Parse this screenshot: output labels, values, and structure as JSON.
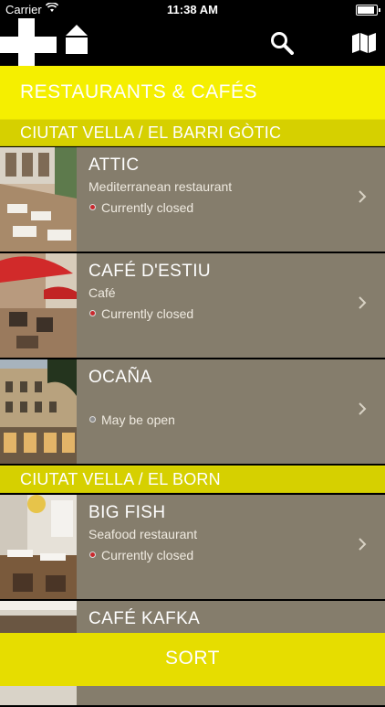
{
  "status_bar": {
    "carrier": "Carrier",
    "time": "11:38 AM"
  },
  "nav": {
    "icons": [
      "plus-icon",
      "home-icon",
      "search-icon",
      "map-icon"
    ]
  },
  "title": "RESTAURANTS & CAFÉS",
  "sections": [
    {
      "title": "CIUTAT VELLA / EL BARRI GÒTIC",
      "items": [
        {
          "name": "ATTIC",
          "type": "Mediterranean restaurant",
          "status": "Currently closed",
          "status_kind": "closed"
        },
        {
          "name": "CAFÉ D'ESTIU",
          "type": "Café",
          "status": "Currently closed",
          "status_kind": "closed"
        },
        {
          "name": "OCAÑA",
          "type": "",
          "status": "May be open",
          "status_kind": "maybe"
        }
      ]
    },
    {
      "title": "CIUTAT VELLA / EL BORN",
      "items": [
        {
          "name": "BIG FISH",
          "type": "Seafood restaurant",
          "status": "Currently closed",
          "status_kind": "closed"
        },
        {
          "name": "CAFÉ KAFKA",
          "type": "",
          "status": "",
          "status_kind": ""
        }
      ]
    }
  ],
  "sort_label": "SORT",
  "colors": {
    "title_yellow": "#f5ef00",
    "section_yellow": "#d6d000",
    "row_bg": "#857d6c",
    "closed_dot": "#c8282d"
  }
}
